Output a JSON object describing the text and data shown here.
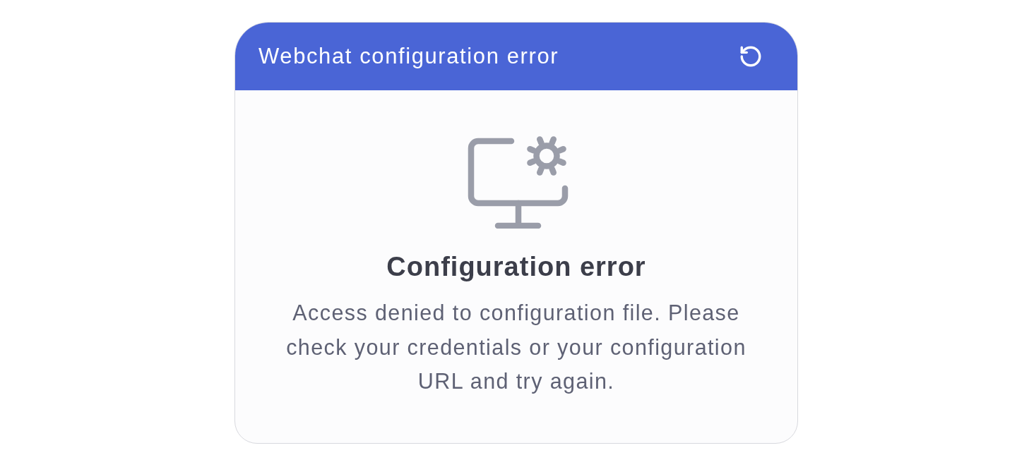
{
  "header": {
    "title": "Webchat configuration error"
  },
  "message": {
    "title": "Configuration error",
    "text": "Access denied to configuration file. Please check your credentials or your configuration URL and try again."
  }
}
